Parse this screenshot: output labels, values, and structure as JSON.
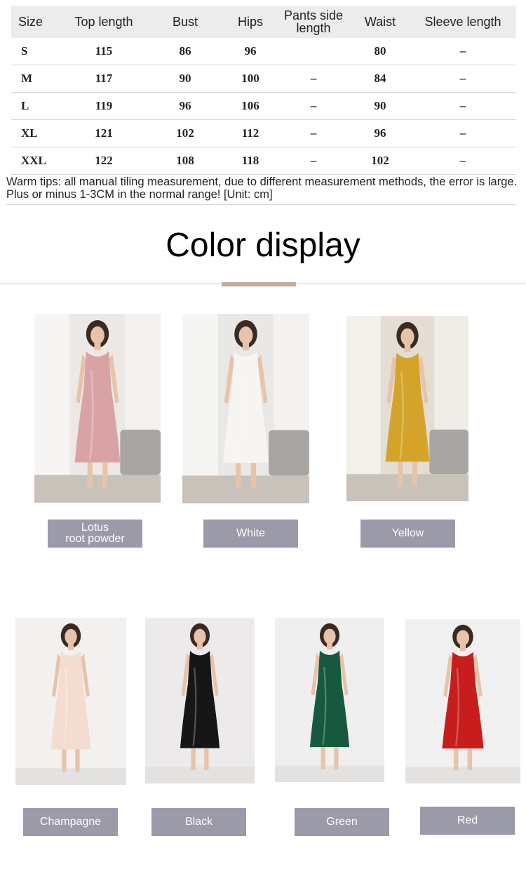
{
  "size_table": {
    "headers": [
      "Size",
      "Top length",
      "Bust",
      "Hips",
      "Pants side length",
      "Waist",
      "Sleeve length"
    ],
    "rows": [
      [
        "S",
        "115",
        "86",
        "96",
        "",
        "80",
        "–"
      ],
      [
        "M",
        "117",
        "90",
        "100",
        "–",
        "84",
        "–"
      ],
      [
        "L",
        "119",
        "96",
        "106",
        "–",
        "90",
        "–"
      ],
      [
        "XL",
        "121",
        "102",
        "112",
        "–",
        "96",
        "–"
      ],
      [
        "XXL",
        "122",
        "108",
        "118",
        "–",
        "102",
        "–"
      ]
    ]
  },
  "tips": "Warm tips: all manual tiling measurement, due to different measurement methods, the error is large. Plus or minus 1-3CM in the normal range! [Unit: cm]",
  "section_title": "Color display",
  "colors": [
    {
      "label_line1": "Lotus",
      "label_line2": "root powder",
      "dress_color": "#d9a3a6",
      "bg": "#ece8e6"
    },
    {
      "label": "White",
      "dress_color": "#f7f5f2",
      "bg": "#e9e8e6"
    },
    {
      "label": "Yellow",
      "dress_color": "#d4a42a",
      "bg": "#e4ddd3"
    },
    {
      "label": "Champagne",
      "dress_color": "#f4ddd0",
      "bg": "#f2f1ef"
    },
    {
      "label": "Black",
      "dress_color": "#161616",
      "bg": "#eceaea"
    },
    {
      "label": "Green",
      "dress_color": "#17593f",
      "bg": "#efefef"
    },
    {
      "label": "Red",
      "dress_color": "#c81d1d",
      "bg": "#f1f0f0"
    }
  ],
  "label_bg": "#9b9aa8"
}
